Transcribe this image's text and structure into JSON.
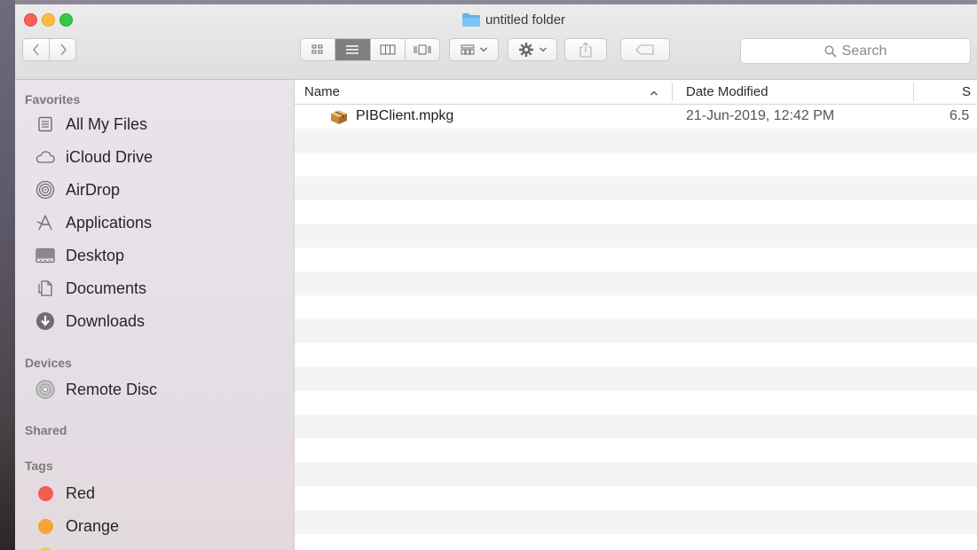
{
  "window": {
    "title": "untitled folder"
  },
  "toolbar": {
    "nav_back_icon": "chevron-left-icon",
    "nav_forward_icon": "chevron-right-icon",
    "view_modes": [
      "icon-view",
      "list-view",
      "column-view",
      "cover-flow-view"
    ],
    "active_view": "list-view",
    "search_placeholder": "Search"
  },
  "sidebar": {
    "sections": {
      "favorites": "Favorites",
      "devices": "Devices",
      "shared": "Shared",
      "tags": "Tags"
    },
    "favorites": [
      {
        "label": "All My Files",
        "icon": "all-files-icon"
      },
      {
        "label": "iCloud Drive",
        "icon": "cloud-icon"
      },
      {
        "label": "AirDrop",
        "icon": "airdrop-icon"
      },
      {
        "label": "Applications",
        "icon": "applications-icon"
      },
      {
        "label": "Desktop",
        "icon": "desktop-icon"
      },
      {
        "label": "Documents",
        "icon": "documents-icon"
      },
      {
        "label": "Downloads",
        "icon": "downloads-icon"
      }
    ],
    "devices": [
      {
        "label": "Remote Disc",
        "icon": "disc-icon"
      }
    ],
    "tags": [
      {
        "label": "Red",
        "color": "#f25a56"
      },
      {
        "label": "Orange",
        "color": "#f7a436"
      }
    ]
  },
  "list": {
    "columns": {
      "name": "Name",
      "date": "Date Modified",
      "size": "S"
    },
    "files": [
      {
        "name": "PIBClient.mpkg",
        "date": "21-Jun-2019, 12:42 PM",
        "size": "6.5"
      }
    ]
  }
}
